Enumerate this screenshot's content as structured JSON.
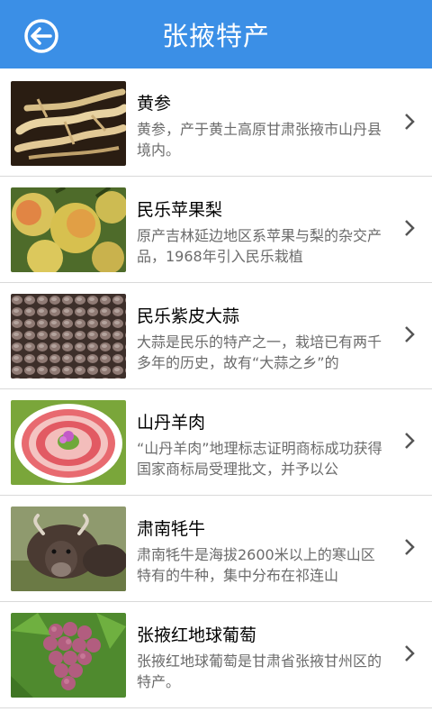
{
  "header": {
    "title": "张掖特产"
  },
  "items": [
    {
      "name": "黄参",
      "desc": "黄参，产于黄土高原甘肃张掖市山丹县境内。",
      "thumb": "ginseng-roots"
    },
    {
      "name": "民乐苹果梨",
      "desc": "原产吉林延边地区系苹果与梨的杂交产品，1968年引入民乐栽植",
      "thumb": "apple-pears"
    },
    {
      "name": "民乐紫皮大蒜",
      "desc": "大蒜是民乐的特产之一，栽培已有两千多年的历史，故有“大蒜之乡”的",
      "thumb": "purple-garlic"
    },
    {
      "name": "山丹羊肉",
      "desc": "“山丹羊肉”地理标志证明商标成功获得国家商标局受理批文，并予以公",
      "thumb": "mutton-platter"
    },
    {
      "name": "肃南牦牛",
      "desc": "肃南牦牛是海拔2600米以上的寒山区特有的牛种，集中分布在祁连山",
      "thumb": "yak"
    },
    {
      "name": "张掖红地球葡萄",
      "desc": "张掖红地球葡萄是甘肃省张掖甘州区的特产。",
      "thumb": "red-grapes"
    }
  ]
}
